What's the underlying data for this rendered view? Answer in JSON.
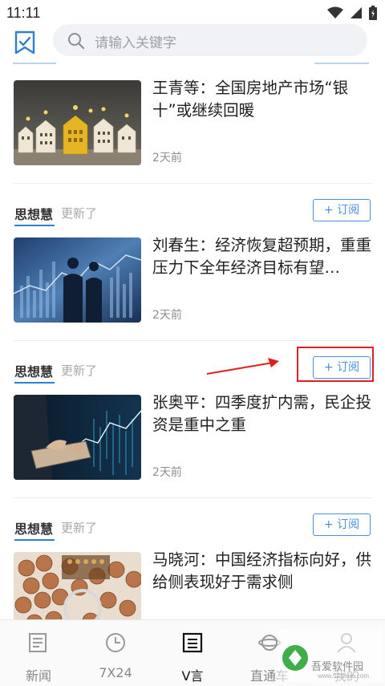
{
  "status_bar": {
    "time": "11:11"
  },
  "search": {
    "placeholder": "请输入关键字"
  },
  "articles": [
    {
      "title": "王青等：全国房地产市场“银十”或继续回暖",
      "time": "2天前"
    },
    {
      "author": "思想慧",
      "updated": "更新了",
      "subscribe": "+ 订阅",
      "title": "刘春生：经济恢复超预期，重重压力下全年经济目标有望…",
      "time": "2天前"
    },
    {
      "author": "思想慧",
      "updated": "更新了",
      "subscribe": "+ 订阅",
      "title": "张奥平：四季度扩内需，民企投资是重中之重",
      "time": "2天前"
    },
    {
      "author": "思想慧",
      "updated": "更新了",
      "subscribe": "+ 订阅",
      "title": "马晓河：中国经济指标向好，供给侧表现好于需求侧"
    }
  ],
  "tabs": [
    {
      "label": "新闻",
      "icon": "news-icon",
      "active": false
    },
    {
      "label": "7X24",
      "icon": "clock-icon",
      "active": false
    },
    {
      "label": "V言",
      "icon": "document-icon",
      "active": true
    },
    {
      "label": "直通车",
      "icon": "planet-icon",
      "active": false
    },
    {
      "label": "我的",
      "icon": "user-icon",
      "active": false
    }
  ],
  "watermark": {
    "text": "吾爱软件园",
    "url": "www.52zixue.com"
  },
  "colors": {
    "accent": "#4a90e2",
    "highlight": "#e02020"
  }
}
